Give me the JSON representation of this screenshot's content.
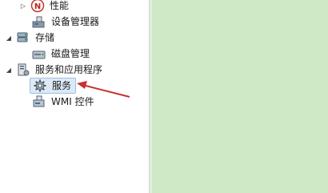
{
  "tree": {
    "items": [
      {
        "label": "性能",
        "toggle": "▷"
      },
      {
        "label": "设备管理器",
        "toggle": ""
      },
      {
        "label": "存储",
        "toggle": "◢"
      },
      {
        "label": "磁盘管理",
        "toggle": ""
      },
      {
        "label": "服务和应用程序",
        "toggle": "◢"
      },
      {
        "label": "服务",
        "toggle": ""
      },
      {
        "label": "WMI 控件",
        "toggle": ""
      }
    ]
  },
  "colors": {
    "right_pane": "#cfe8c6",
    "arrow": "#c8312f",
    "selection": "#dce9f6"
  }
}
